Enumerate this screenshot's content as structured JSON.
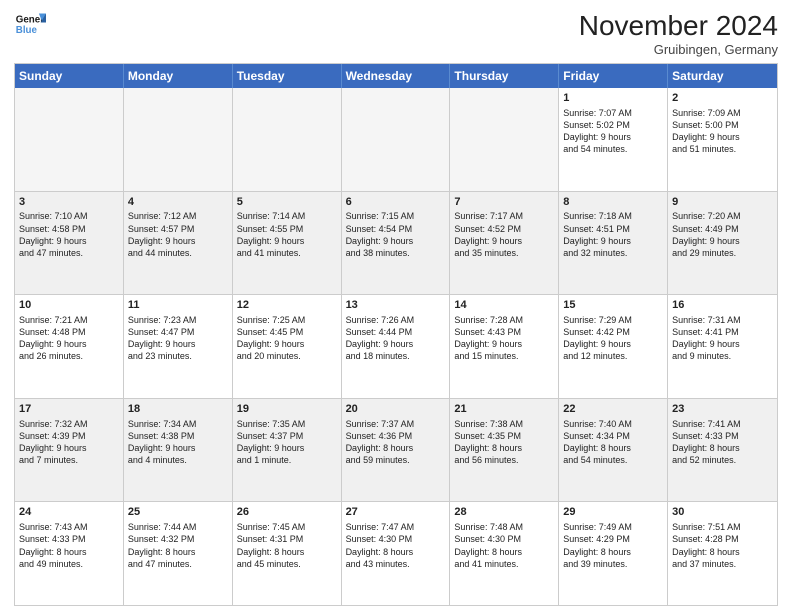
{
  "header": {
    "logo_line1": "General",
    "logo_line2": "Blue",
    "month_title": "November 2024",
    "location": "Gruibingen, Germany"
  },
  "weekdays": [
    "Sunday",
    "Monday",
    "Tuesday",
    "Wednesday",
    "Thursday",
    "Friday",
    "Saturday"
  ],
  "rows": [
    [
      {
        "day": "",
        "empty": true
      },
      {
        "day": "",
        "empty": true
      },
      {
        "day": "",
        "empty": true
      },
      {
        "day": "",
        "empty": true
      },
      {
        "day": "",
        "empty": true
      },
      {
        "day": "1",
        "lines": [
          "Sunrise: 7:07 AM",
          "Sunset: 5:02 PM",
          "Daylight: 9 hours",
          "and 54 minutes."
        ]
      },
      {
        "day": "2",
        "lines": [
          "Sunrise: 7:09 AM",
          "Sunset: 5:00 PM",
          "Daylight: 9 hours",
          "and 51 minutes."
        ]
      }
    ],
    [
      {
        "day": "3",
        "alt": true,
        "lines": [
          "Sunrise: 7:10 AM",
          "Sunset: 4:58 PM",
          "Daylight: 9 hours",
          "and 47 minutes."
        ]
      },
      {
        "day": "4",
        "alt": true,
        "lines": [
          "Sunrise: 7:12 AM",
          "Sunset: 4:57 PM",
          "Daylight: 9 hours",
          "and 44 minutes."
        ]
      },
      {
        "day": "5",
        "alt": true,
        "lines": [
          "Sunrise: 7:14 AM",
          "Sunset: 4:55 PM",
          "Daylight: 9 hours",
          "and 41 minutes."
        ]
      },
      {
        "day": "6",
        "alt": true,
        "lines": [
          "Sunrise: 7:15 AM",
          "Sunset: 4:54 PM",
          "Daylight: 9 hours",
          "and 38 minutes."
        ]
      },
      {
        "day": "7",
        "alt": true,
        "lines": [
          "Sunrise: 7:17 AM",
          "Sunset: 4:52 PM",
          "Daylight: 9 hours",
          "and 35 minutes."
        ]
      },
      {
        "day": "8",
        "alt": true,
        "lines": [
          "Sunrise: 7:18 AM",
          "Sunset: 4:51 PM",
          "Daylight: 9 hours",
          "and 32 minutes."
        ]
      },
      {
        "day": "9",
        "alt": true,
        "lines": [
          "Sunrise: 7:20 AM",
          "Sunset: 4:49 PM",
          "Daylight: 9 hours",
          "and 29 minutes."
        ]
      }
    ],
    [
      {
        "day": "10",
        "lines": [
          "Sunrise: 7:21 AM",
          "Sunset: 4:48 PM",
          "Daylight: 9 hours",
          "and 26 minutes."
        ]
      },
      {
        "day": "11",
        "lines": [
          "Sunrise: 7:23 AM",
          "Sunset: 4:47 PM",
          "Daylight: 9 hours",
          "and 23 minutes."
        ]
      },
      {
        "day": "12",
        "lines": [
          "Sunrise: 7:25 AM",
          "Sunset: 4:45 PM",
          "Daylight: 9 hours",
          "and 20 minutes."
        ]
      },
      {
        "day": "13",
        "lines": [
          "Sunrise: 7:26 AM",
          "Sunset: 4:44 PM",
          "Daylight: 9 hours",
          "and 18 minutes."
        ]
      },
      {
        "day": "14",
        "lines": [
          "Sunrise: 7:28 AM",
          "Sunset: 4:43 PM",
          "Daylight: 9 hours",
          "and 15 minutes."
        ]
      },
      {
        "day": "15",
        "lines": [
          "Sunrise: 7:29 AM",
          "Sunset: 4:42 PM",
          "Daylight: 9 hours",
          "and 12 minutes."
        ]
      },
      {
        "day": "16",
        "lines": [
          "Sunrise: 7:31 AM",
          "Sunset: 4:41 PM",
          "Daylight: 9 hours",
          "and 9 minutes."
        ]
      }
    ],
    [
      {
        "day": "17",
        "alt": true,
        "lines": [
          "Sunrise: 7:32 AM",
          "Sunset: 4:39 PM",
          "Daylight: 9 hours",
          "and 7 minutes."
        ]
      },
      {
        "day": "18",
        "alt": true,
        "lines": [
          "Sunrise: 7:34 AM",
          "Sunset: 4:38 PM",
          "Daylight: 9 hours",
          "and 4 minutes."
        ]
      },
      {
        "day": "19",
        "alt": true,
        "lines": [
          "Sunrise: 7:35 AM",
          "Sunset: 4:37 PM",
          "Daylight: 9 hours",
          "and 1 minute."
        ]
      },
      {
        "day": "20",
        "alt": true,
        "lines": [
          "Sunrise: 7:37 AM",
          "Sunset: 4:36 PM",
          "Daylight: 8 hours",
          "and 59 minutes."
        ]
      },
      {
        "day": "21",
        "alt": true,
        "lines": [
          "Sunrise: 7:38 AM",
          "Sunset: 4:35 PM",
          "Daylight: 8 hours",
          "and 56 minutes."
        ]
      },
      {
        "day": "22",
        "alt": true,
        "lines": [
          "Sunrise: 7:40 AM",
          "Sunset: 4:34 PM",
          "Daylight: 8 hours",
          "and 54 minutes."
        ]
      },
      {
        "day": "23",
        "alt": true,
        "lines": [
          "Sunrise: 7:41 AM",
          "Sunset: 4:33 PM",
          "Daylight: 8 hours",
          "and 52 minutes."
        ]
      }
    ],
    [
      {
        "day": "24",
        "lines": [
          "Sunrise: 7:43 AM",
          "Sunset: 4:33 PM",
          "Daylight: 8 hours",
          "and 49 minutes."
        ]
      },
      {
        "day": "25",
        "lines": [
          "Sunrise: 7:44 AM",
          "Sunset: 4:32 PM",
          "Daylight: 8 hours",
          "and 47 minutes."
        ]
      },
      {
        "day": "26",
        "lines": [
          "Sunrise: 7:45 AM",
          "Sunset: 4:31 PM",
          "Daylight: 8 hours",
          "and 45 minutes."
        ]
      },
      {
        "day": "27",
        "lines": [
          "Sunrise: 7:47 AM",
          "Sunset: 4:30 PM",
          "Daylight: 8 hours",
          "and 43 minutes."
        ]
      },
      {
        "day": "28",
        "lines": [
          "Sunrise: 7:48 AM",
          "Sunset: 4:30 PM",
          "Daylight: 8 hours",
          "and 41 minutes."
        ]
      },
      {
        "day": "29",
        "lines": [
          "Sunrise: 7:49 AM",
          "Sunset: 4:29 PM",
          "Daylight: 8 hours",
          "and 39 minutes."
        ]
      },
      {
        "day": "30",
        "lines": [
          "Sunrise: 7:51 AM",
          "Sunset: 4:28 PM",
          "Daylight: 8 hours",
          "and 37 minutes."
        ]
      }
    ]
  ]
}
